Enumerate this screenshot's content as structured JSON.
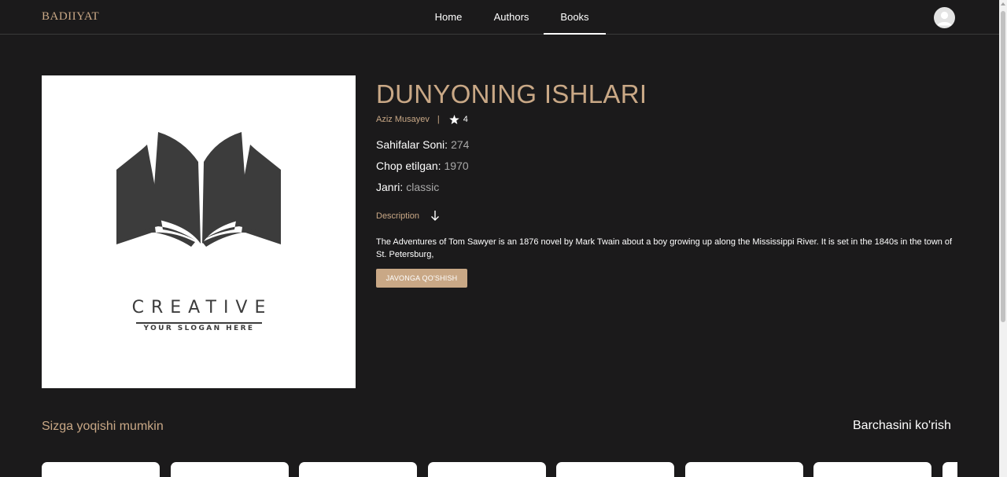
{
  "header": {
    "logo": "BADIIYAT",
    "nav": [
      "Home",
      "Authors",
      "Books"
    ],
    "active": "Books"
  },
  "book": {
    "title": "DUNYONING ISHLARI",
    "author": "Aziz Musayev",
    "separator": "|",
    "rating": "4",
    "details": [
      {
        "label": "Sahifalar Soni:",
        "value": "274"
      },
      {
        "label": "Chop etilgan:",
        "value": "1970"
      },
      {
        "label": "Janri:",
        "value": "classic"
      }
    ],
    "description_label": "Description",
    "description": "The Adventures of Tom Sawyer is an 1876 novel by Mark Twain about a boy growing up along the Mississippi River. It is set in the 1840s in the town of St. Petersburg,",
    "add_button": "JAVONGA QO'SHISH",
    "cover": {
      "brand": "CREATIVE",
      "slogan": "YOUR SLOGAN HERE"
    }
  },
  "recommend": {
    "title": "Sizga yoqishi mumkin",
    "see_all": "Barchasini ko'rish"
  },
  "colors": {
    "accent": "#c9a886",
    "background": "#1b1a1b"
  }
}
